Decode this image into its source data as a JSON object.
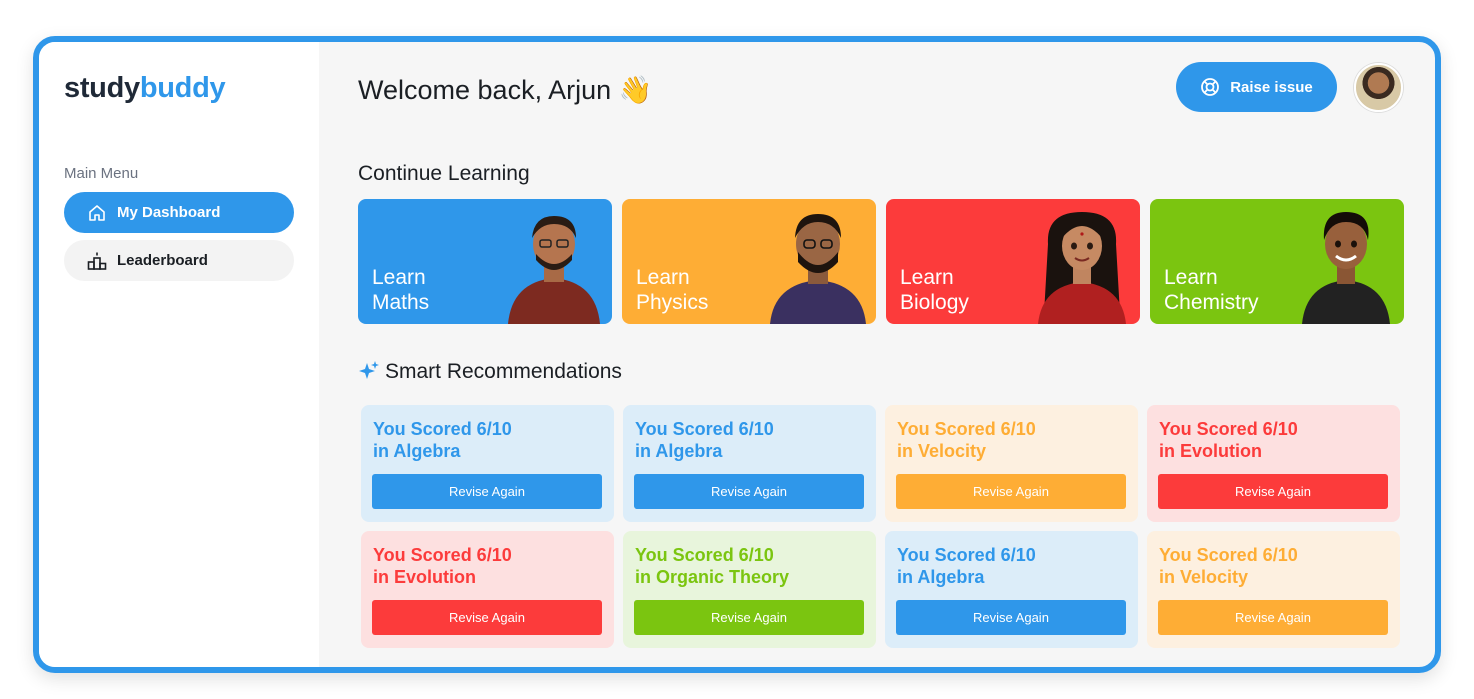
{
  "brand": {
    "part1": "study",
    "part2": "buddy"
  },
  "sidebar": {
    "menu_title": "Main Menu",
    "items": [
      {
        "label": "My Dashboard",
        "icon": "home-icon",
        "active": true
      },
      {
        "label": "Leaderboard",
        "icon": "podium-icon",
        "active": false
      }
    ]
  },
  "header": {
    "welcome": "Welcome back, Arjun 👋",
    "raise_issue": "Raise issue",
    "raise_icon": "lifebuoy-icon"
  },
  "continue_learning": {
    "title": "Continue Learning",
    "cards": [
      {
        "line1": "Learn",
        "line2": "Maths",
        "color": "#2f97ea",
        "shirt": "#7d2a20"
      },
      {
        "line1": "Learn",
        "line2": "Physics",
        "color": "#fead35",
        "shirt": "#3a3060"
      },
      {
        "line1": "Learn",
        "line2": "Biology",
        "color": "#fc3b3b",
        "shirt": "#b02020"
      },
      {
        "line1": "Learn",
        "line2": "Chemistry",
        "color": "#7bc510",
        "shirt": "#222222"
      }
    ]
  },
  "recommendations": {
    "title": "Smart Recommendations",
    "items": [
      {
        "line1": "You Scored 6/10",
        "line2": "in Algebra",
        "button": "Revise Again",
        "accent": "#2f97ea",
        "bg": "#dcedf9"
      },
      {
        "line1": "You Scored 6/10",
        "line2": "in Algebra",
        "button": "Revise Again",
        "accent": "#2f97ea",
        "bg": "#dcedf9"
      },
      {
        "line1": "You Scored 6/10",
        "line2": "in Velocity",
        "button": "Revise Again",
        "accent": "#fead35",
        "bg": "#fdf0e0"
      },
      {
        "line1": "You Scored 6/10",
        "line2": "in Evolution",
        "button": "Revise Again",
        "accent": "#fc3b3b",
        "bg": "#fde0e0"
      },
      {
        "line1": "You Scored 6/10",
        "line2": "in Evolution",
        "button": "Revise Again",
        "accent": "#fc3b3b",
        "bg": "#fde0e0"
      },
      {
        "line1": "You Scored 6/10",
        "line2": "in Organic Theory",
        "button": "Revise Again",
        "accent": "#7bc510",
        "bg": "#e8f5dc"
      },
      {
        "line1": "You Scored 6/10",
        "line2": "in Algebra",
        "button": "Revise Again",
        "accent": "#2f97ea",
        "bg": "#dcedf9"
      },
      {
        "line1": "You Scored 6/10",
        "line2": "in Velocity",
        "button": "Revise Again",
        "accent": "#fead35",
        "bg": "#fdf0e0"
      }
    ]
  }
}
